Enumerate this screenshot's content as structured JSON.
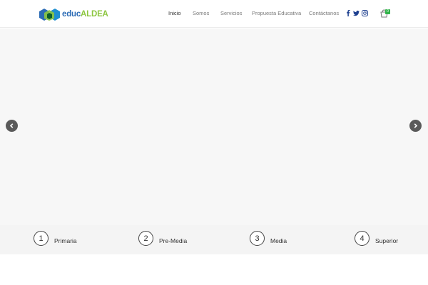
{
  "brand": {
    "name_part1": "educ",
    "name_part2": "ALDEA"
  },
  "nav": {
    "items": [
      {
        "label": "Inicio",
        "active": true
      },
      {
        "label": "Somos",
        "active": false
      },
      {
        "label": "Servicios",
        "active": false
      },
      {
        "label": "Propuesta Educativa",
        "active": false
      },
      {
        "label": "Contáctanos",
        "active": false
      }
    ]
  },
  "social": {
    "icons": [
      "facebook-icon",
      "twitter-icon",
      "instagram-icon"
    ]
  },
  "cart": {
    "count": "0",
    "icon": "shopping-bag-icon"
  },
  "slider": {
    "prev_icon": "chevron-left-icon",
    "next_icon": "chevron-right-icon"
  },
  "steps": [
    {
      "number": "1",
      "label": "Primaria"
    },
    {
      "number": "2",
      "label": "Pre-Media"
    },
    {
      "number": "3",
      "label": "Media"
    },
    {
      "number": "4",
      "label": "Superior"
    }
  ],
  "colors": {
    "brand_blue": "#2b6bb5",
    "brand_green": "#8cc63f",
    "badge_green": "#32b34a",
    "social_blue": "#1d3f8f",
    "slider_bg": "#f7f7f7",
    "arrow_bg": "#5a5a5a"
  }
}
